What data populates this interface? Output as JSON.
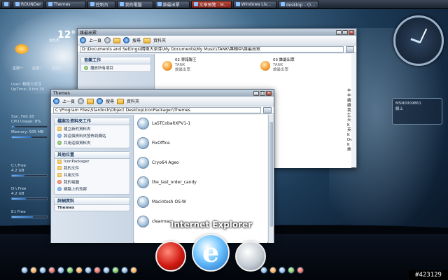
{
  "taskbar": {
    "buttons": [
      {
        "label": "",
        "icon": "start-icon"
      },
      {
        "label": "ROUNDer",
        "icon": "app-icon"
      },
      {
        "label": "Themes",
        "icon": "folder-icon"
      },
      {
        "label": "控制台",
        "icon": "control-panel-icon"
      },
      {
        "label": "我的電腦",
        "icon": "computer-icon"
      },
      {
        "label": "誰最出眾",
        "icon": "folder-icon"
      },
      {
        "label": "文章預覽 - M...",
        "icon": "browser-icon"
      },
      {
        "label": "Windows Liv...",
        "icon": "messenger-icon"
      },
      {
        "label": "desktop - 小...",
        "icon": "paint-icon"
      }
    ]
  },
  "weather": {
    "temp": "12°",
    "city": "台北市",
    "days": [
      "星期一",
      "星期二",
      "星期三"
    ]
  },
  "sysinfo": {
    "user": "User: 精緻大奈芽",
    "uptime": "UpTime: 9 hrs 30",
    "date": "Sun, Feb 18",
    "cpu": "CPU Usage: 8%",
    "cpu_fraction": 0.08,
    "memory": "Memory: 935 MB",
    "memory_fraction": 0.55,
    "drives": [
      {
        "label": "C:\\ Free",
        "value": "4.2 GB",
        "fraction": 0.35
      },
      {
        "label": "D:\\ Free",
        "value": "4.2 GB",
        "fraction": 0.4
      },
      {
        "label": "E:\\ Free",
        "value": "",
        "fraction": 0.6
      }
    ]
  },
  "contact": {
    "line1": "MSN0009861",
    "line2": "線上"
  },
  "window_back": {
    "title": "誰最出眾",
    "address": "D:\\Documents and Settings\\精緻大奈芽\\My Documents\\My Music\\TANK\\專輯中\\誰最出眾",
    "back_label": "上一頁",
    "search_label": "搜尋",
    "folders_label": "資料夾",
    "task_group": "音樂工作",
    "task_item": "播放所有項目",
    "files": [
      {
        "name": "02 寄錯聯王",
        "artist": "TANK",
        "album": "誰最出眾"
      },
      {
        "name": "03 誰最出眾",
        "artist": "TANK",
        "album": "誰最出眾"
      }
    ],
    "right_items": [
      "丰",
      "丰",
      "續",
      "續天使",
      "我",
      "生",
      "天使翅",
      "K",
      "英雄的光光",
      "K",
      "Dear Tank",
      "K",
      "誰最出眾"
    ]
  },
  "window_front": {
    "title": "Themes",
    "address": "C:\\Program Files\\Stardock\\Object Desktop\\IconPackager\\Themes",
    "back_label": "上一頁",
    "search_label": "搜尋",
    "folders_label": "資料夾",
    "groups": [
      {
        "head": "檔案及資料夾工作",
        "items": [
          "建立新的資料夾",
          "將這個資料夾發佈到網站",
          "共用這個資料夾"
        ]
      },
      {
        "head": "其他位置",
        "items": [
          "IconPackager",
          "我的文件",
          "共用文件",
          "我的電腦",
          "網路上的芳鄰"
        ]
      },
      {
        "head": "詳細資料",
        "items": [
          "Themes"
        ]
      }
    ],
    "files": [
      "LaSTCobaltXPV1-1",
      "FixOffice",
      "Cryo64 Ageo",
      "the_last_order_candy",
      "Macintosh OS-W",
      "clearmac"
    ]
  },
  "dock": {
    "label": "Internet Explorer",
    "items": [
      "flash-icon",
      "internet-explorer-icon",
      "firefox-icon"
    ]
  },
  "watermark": "#423129"
}
